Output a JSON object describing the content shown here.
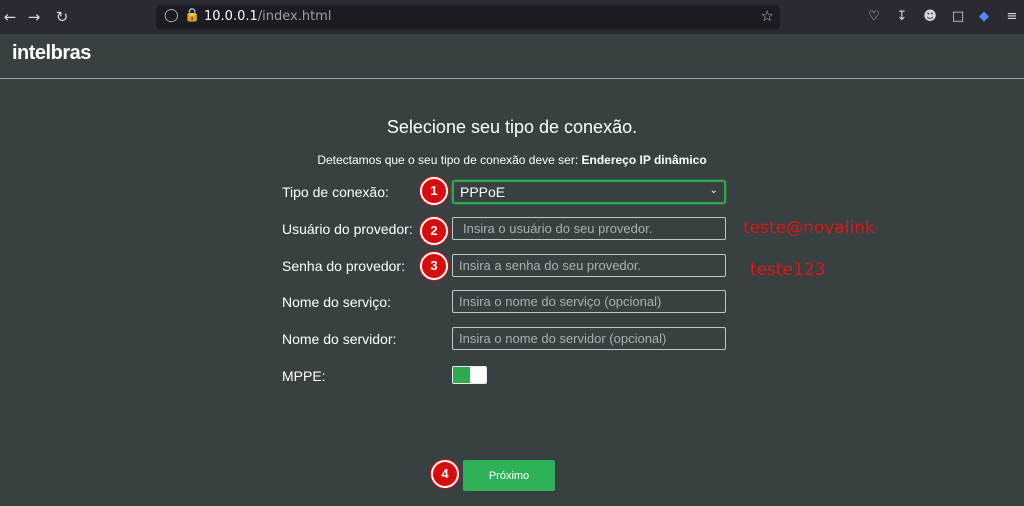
{
  "browser": {
    "url_host": "10.0.0.1",
    "url_path": "/index.html",
    "icons": [
      "back-icon",
      "forward-icon",
      "reload-icon",
      "shield-icon",
      "lock-icon",
      "star-icon",
      "pocket-icon",
      "download-icon",
      "account-icon",
      "extensions-icon",
      "ublock-icon",
      "menu-icon"
    ]
  },
  "header": {
    "logo": "intelbras"
  },
  "page": {
    "title": "Selecione seu tipo de conexão.",
    "detect_prefix": "Detectamos que o seu tipo de conexão deve ser: ",
    "detect_value": "Endereço IP dinâmico"
  },
  "form": {
    "connection_type": {
      "label": "Tipo de conexão:",
      "value": "PPPoE"
    },
    "provider_user": {
      "label": "Usuário do provedor:",
      "placeholder": "Insira o usuário do seu provedor."
    },
    "provider_password": {
      "label": "Senha do provedor:",
      "placeholder": "Insira a senha do seu provedor."
    },
    "service_name": {
      "label": "Nome do serviço:",
      "placeholder": "Insira o nome do serviço (opcional)"
    },
    "server_name": {
      "label": "Nome do servidor:",
      "placeholder": "Insira o nome do servidor (opcional)"
    },
    "mppe": {
      "label": "MPPE:",
      "enabled": true
    }
  },
  "next_button": "Próximo",
  "annotations": {
    "steps": [
      "1",
      "2",
      "3",
      "4"
    ],
    "user_example": "teste@novalink",
    "password_example": "teste123",
    "color": "#e01515"
  },
  "colors": {
    "accent": "#2ea94e",
    "background": "#384042"
  }
}
